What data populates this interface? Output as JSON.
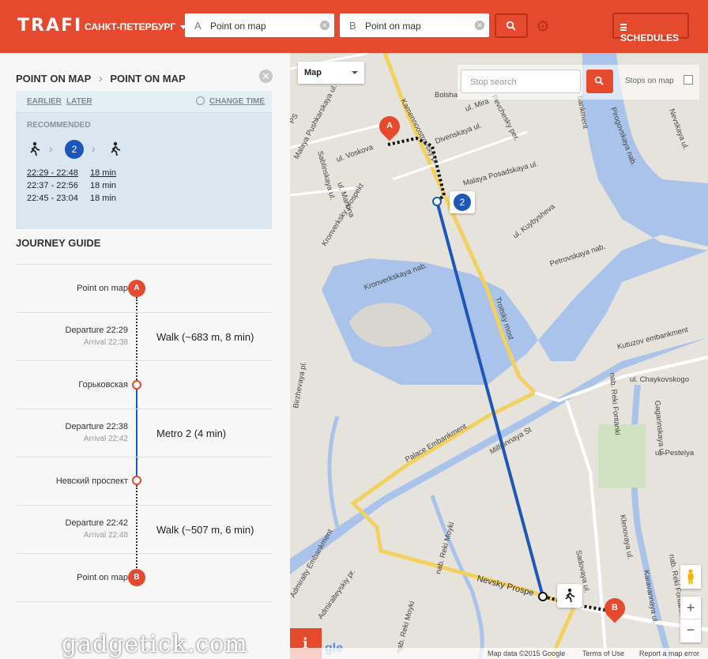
{
  "header": {
    "logo": "TRAFI",
    "city": "САНКТ-ПЕТЕРБУРГ",
    "from": {
      "label": "A",
      "value": "Point on map"
    },
    "to": {
      "label": "B",
      "value": "Point on map"
    },
    "schedules_label": "SCHEDULES",
    "brand_color": "#e64a2e"
  },
  "route": {
    "from": "POINT ON MAP",
    "separator": "›",
    "to": "POINT ON MAP",
    "earlier": "EARLIER",
    "later": "LATER",
    "change_time": "CHANGE TIME",
    "recommended": "RECOMMENDED",
    "transfer_badge": "2",
    "options": [
      {
        "time": "22:29 - 22:48",
        "duration": "18 min"
      },
      {
        "time": "22:37 - 22:56",
        "duration": "18 min"
      },
      {
        "time": "22:45 - 23:04",
        "duration": "18 min"
      }
    ]
  },
  "journey": {
    "title": "JOURNEY GUIDE",
    "start": {
      "name": "Point on map",
      "marker": "A"
    },
    "seg1": {
      "departure": "Departure 22:29",
      "arrival": "Arrival 22:38",
      "label": "Walk (~683 m, 8 min)"
    },
    "stop1": "Горьковская",
    "seg2": {
      "departure": "Departure 22:38",
      "arrival": "Arrival 22:42",
      "label_bold": "Metro 2",
      "label_rest": " (4 min)"
    },
    "stop2": "Невский проспект",
    "seg3": {
      "departure": "Departure 22:42",
      "arrival": "Arrival 22:48",
      "label": "Walk (~507 m, 6 min)"
    },
    "end": {
      "name": "Point on map",
      "marker": "B"
    }
  },
  "map": {
    "type_select": "Map",
    "stop_search_placeholder": "Stop search",
    "stops_on_map": "Stops on map",
    "zoom_in": "+",
    "zoom_out": "−",
    "info": "i",
    "google": "gle",
    "attribution": "Map data ©2015 Google",
    "terms": "Terms of Use",
    "report": "Report a map error",
    "marker_a": "A",
    "marker_b": "B",
    "metro_badge": "2",
    "labels": {
      "kamennoostrovsky": "Kamennoostrovsky pr.",
      "bolsh": "Bolsha",
      "mira": "ul. Mira",
      "divenskaya": "Divenskaya ul.",
      "pevcheskiy": "Pevchesky per.",
      "pushkarskaya": "Malaya Pushkarskaya ul.",
      "voskova": "ul. Voskova",
      "sablinskaya": "Sablinskaya ul.",
      "markina": "ul. Markina",
      "kronverkskiy": "Kronverksky prospekt",
      "posadskaya": "Malaya Posadskaya ul.",
      "kuybysheva": "ul. Kuybysheva",
      "petrovskaya": "Petrovskaya nab.",
      "kronverkskaya_nab": "Kronverkskaya nab.",
      "troitsky": "Troitsky most",
      "kutuzov": "Kutuzov embankment",
      "chaykovskogo": "ul. Chaykovskogo",
      "pestelya": "ul. Pestelya",
      "palace": "Palace Embankment",
      "millionnaya": "Millionnaya St",
      "birzhevaya": "Birzhevaya pl.",
      "admiralty": "Admiralty Embankment",
      "admiralteyskiy": "Admiralteyskiy pr.",
      "moyki": "nab. Reki Moyki",
      "moyki2": "nab. Reki Moyki",
      "nevsky": "Nevsky Prospe",
      "sadovaya": "Sadovaya ul.",
      "fontanki": "nab. Reki Fontanki",
      "fontanki2": "nab. Reki Fontanki",
      "gagarinskaya": "Gagarinskaya ul.",
      "klenovaya": "Klenovaya ul.",
      "karavannaya": "Karavannaya ul.",
      "pirogovskaya": "Pirogovskaya nab.",
      "nevskaya": "Nevskaya ul.",
      "bankment": "bankment",
      "ps": "PS"
    }
  }
}
